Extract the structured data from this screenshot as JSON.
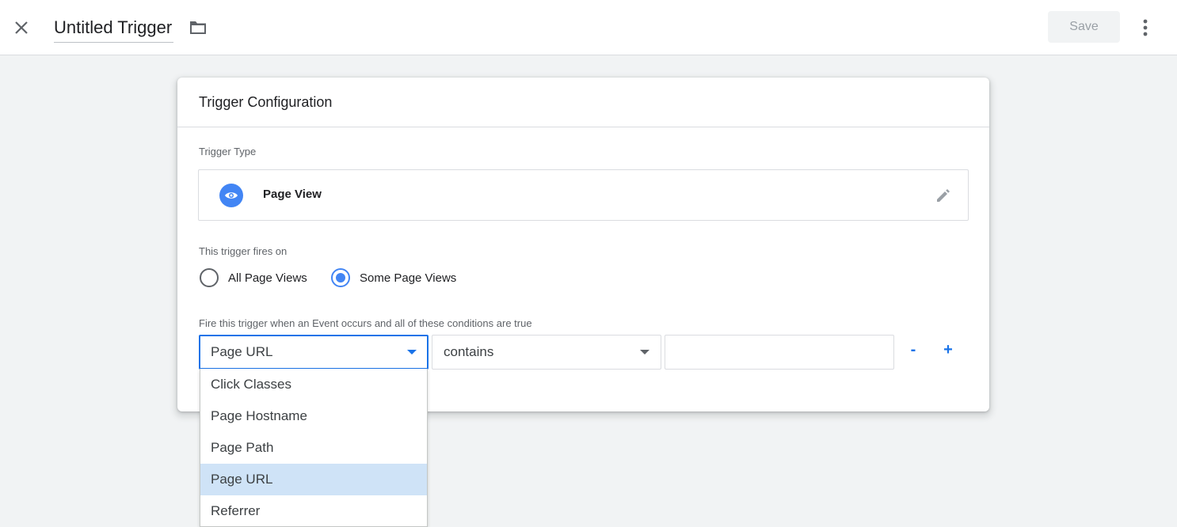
{
  "header": {
    "title": "Untitled Trigger",
    "save_label": "Save"
  },
  "card": {
    "title": "Trigger Configuration",
    "trigger_type_label": "Trigger Type",
    "trigger_type_name": "Page View",
    "fires_on_label": "This trigger fires on",
    "radio_options": [
      {
        "label": "All Page Views",
        "checked": false
      },
      {
        "label": "Some Page Views",
        "checked": true
      }
    ],
    "conditions_label": "Fire this trigger when an Event occurs and all of these conditions are true",
    "condition": {
      "variable": "Page URL",
      "operator": "contains",
      "value": "",
      "remove_label": "-",
      "add_label": "+"
    }
  },
  "dropdown": {
    "items": [
      {
        "label": "Click Classes",
        "selected": false
      },
      {
        "label": "Page Hostname",
        "selected": false
      },
      {
        "label": "Page Path",
        "selected": false
      },
      {
        "label": "Page URL",
        "selected": true
      },
      {
        "label": "Referrer",
        "selected": false
      }
    ]
  },
  "icons": {
    "close": "close-icon",
    "folder": "folder-icon",
    "more": "more-vert-icon",
    "eye": "eye-icon",
    "edit": "pencil-icon"
  },
  "colors": {
    "accent": "#1a73e8",
    "icon_blue": "#4285f4",
    "selected_item_bg": "#cfe3f7"
  }
}
